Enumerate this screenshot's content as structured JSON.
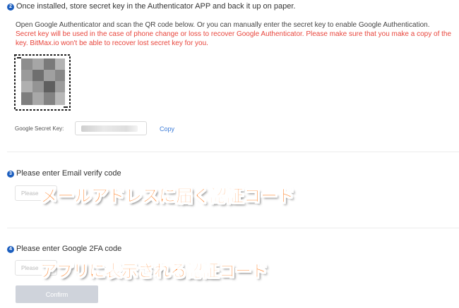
{
  "step2": {
    "number": "2",
    "title": "Once installed, store secret key in the Authenticator APP and back it up on paper.",
    "instruction": "Open Google Authenticator and scan the QR code below. Or you can manually enter the secret key to enable Google Authentication.",
    "warning_line1": "Secret key will be used in the case of phone change or loss to recover Google Authenticator. Please make sure that you make a copy of the",
    "warning_line2": "key. BitMax.io won't be able to recover lost secret key for you.",
    "secret_key_label": "Google Secret Key:",
    "copy_label": "Copy"
  },
  "step3": {
    "number": "3",
    "title": "Please enter Email verify code",
    "placeholder": "Please",
    "overlay_caption": "メールアドレスに届く認証コード"
  },
  "step4": {
    "number": "4",
    "title": "Please enter Google 2FA code",
    "placeholder": "Please",
    "overlay_caption": "アプリに表示される認証コード"
  },
  "confirm_label": "Confirm",
  "colors": {
    "step_badge": "#1d5fbf",
    "warning_text": "#e8453c",
    "link": "#3b7bd8",
    "overlay_text": "#ff7a1a",
    "confirm_disabled": "#cfd3db"
  }
}
